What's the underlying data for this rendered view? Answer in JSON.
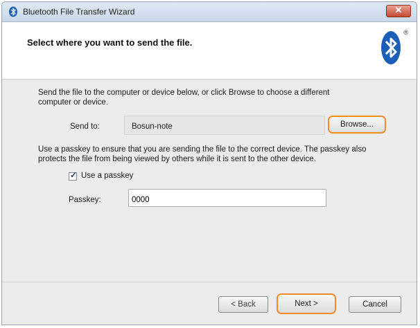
{
  "window": {
    "title": "Bluetooth File Transfer Wizard",
    "close_glyph": "✕"
  },
  "header": {
    "title": "Select where you want to send the file.",
    "logo_icon": "bluetooth-icon",
    "registered_mark": "®"
  },
  "content": {
    "description1": "Send the file to the computer or device below, or click Browse to choose a different computer or device.",
    "send_to_label": "Send to:",
    "send_to_value": "Bosun-note",
    "browse_label": "Browse...",
    "description2": "Use a passkey to ensure that you are sending the file to the correct device. The passkey also protects the file from being viewed by others while it is sent to the other device.",
    "use_passkey_label": "Use a passkey",
    "use_passkey_checked": true,
    "passkey_label": "Passkey:",
    "passkey_value": "0000"
  },
  "footer": {
    "back_label": "< Back",
    "next_label": "Next >",
    "cancel_label": "Cancel"
  },
  "colors": {
    "highlight": "#f18a2b",
    "bluetooth_blue": "#1c5fb8"
  }
}
